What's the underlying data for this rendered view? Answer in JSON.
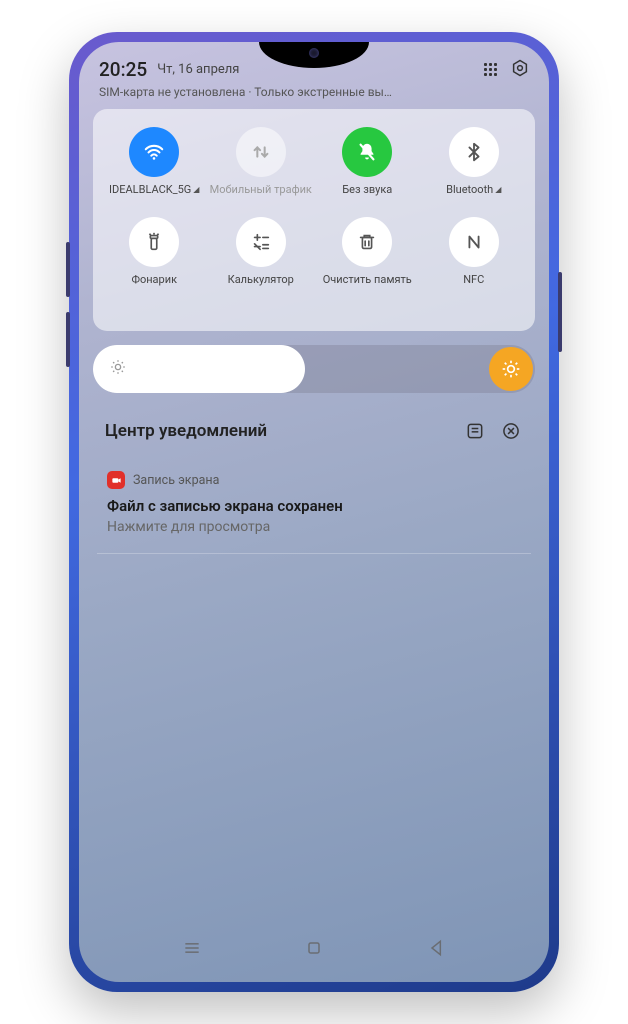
{
  "status": {
    "time": "20:25",
    "date": "Чт, 16 апреля",
    "sim_line": "SIM-карта не установлена · Только экстренные вы…"
  },
  "qs": {
    "row1": [
      {
        "label": "IDEALBLACK_5G",
        "name": "wifi",
        "style": "blue",
        "expandable": true
      },
      {
        "label": "Мобильный трафик",
        "name": "mobile-data",
        "style": "gray",
        "muted": true
      },
      {
        "label": "Без звука",
        "name": "mute",
        "style": "green"
      },
      {
        "label": "Bluetooth",
        "name": "bluetooth",
        "style": "white",
        "expandable": true
      }
    ],
    "row2": [
      {
        "label": "Фонарик",
        "name": "flashlight",
        "style": "white"
      },
      {
        "label": "Калькулятор",
        "name": "calculator",
        "style": "white"
      },
      {
        "label": "Очистить память",
        "name": "clear-memory",
        "style": "white"
      },
      {
        "label": "NFC",
        "name": "nfc",
        "style": "white"
      }
    ]
  },
  "brightness": {
    "level_percent": 48
  },
  "notifications": {
    "header": "Центр уведомлений",
    "items": [
      {
        "app": "Запись экрана",
        "title": "Файл с записью экрана сохранен",
        "subtitle": "Нажмите для просмотра"
      }
    ]
  }
}
